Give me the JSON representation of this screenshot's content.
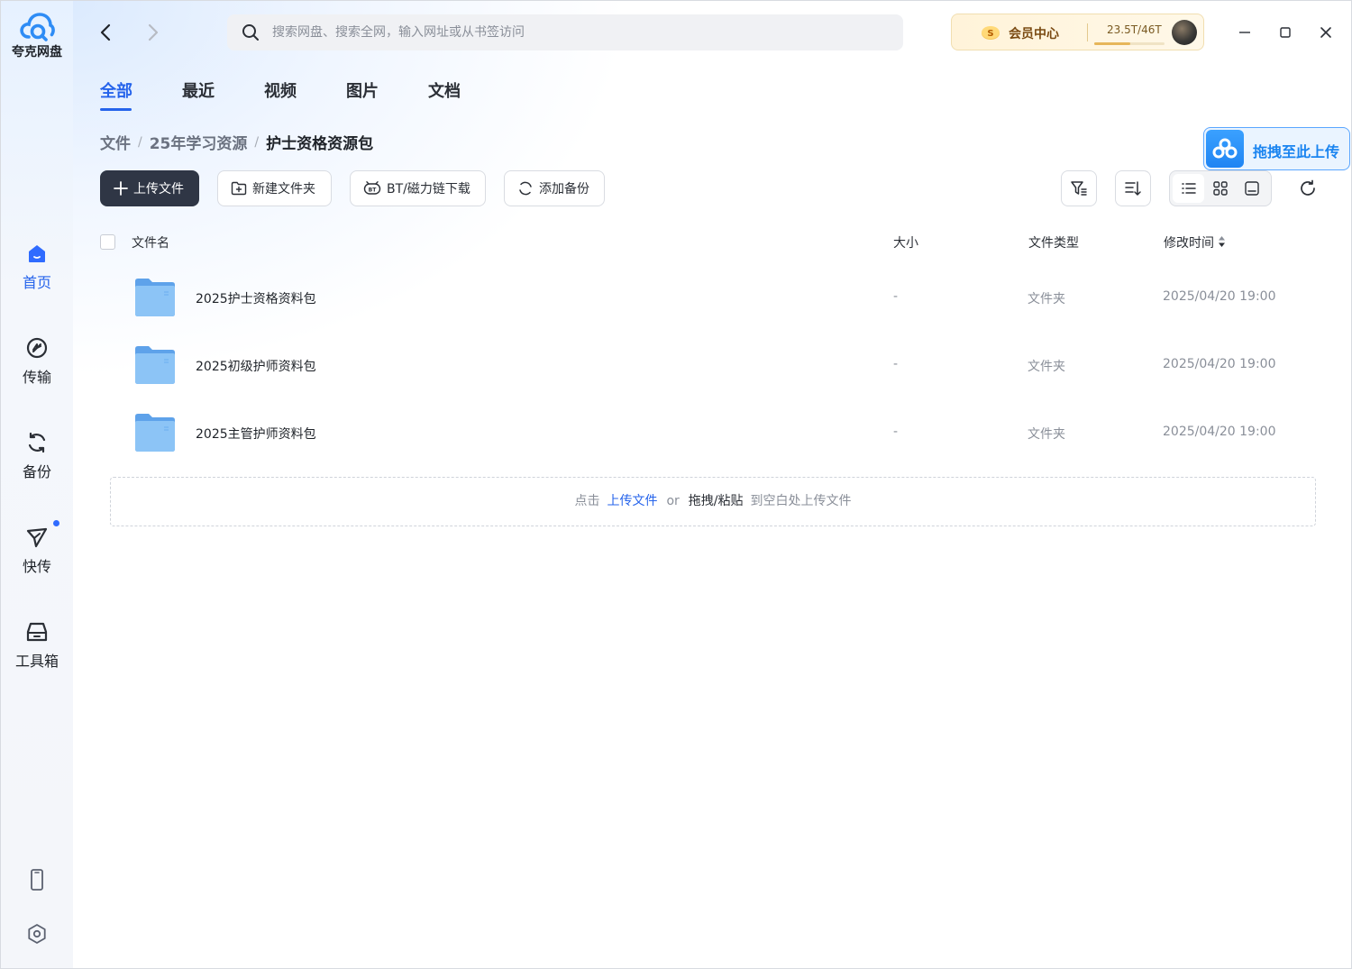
{
  "app": {
    "name": "夸克网盘"
  },
  "sidebar": {
    "items": [
      {
        "label": "首页",
        "icon": "home-icon",
        "active": true
      },
      {
        "label": "传输",
        "icon": "transfer-icon"
      },
      {
        "label": "备份",
        "icon": "backup-icon"
      },
      {
        "label": "快传",
        "icon": "quick-send-icon",
        "badge_dot": true
      },
      {
        "label": "工具箱",
        "icon": "toolbox-icon"
      }
    ],
    "bottom": [
      {
        "icon": "phone-icon"
      },
      {
        "icon": "settings-icon"
      }
    ]
  },
  "topbar": {
    "search_placeholder": "搜索网盘、搜索全网，输入网址或从书签访问",
    "vip_label": "会员中心",
    "storage_text": "23.5T/46T",
    "storage_fraction": 0.51
  },
  "tabs": [
    {
      "label": "全部",
      "active": true
    },
    {
      "label": "最近"
    },
    {
      "label": "视频"
    },
    {
      "label": "图片"
    },
    {
      "label": "文档"
    }
  ],
  "breadcrumb": [
    "文件",
    "25年学习资源",
    "护士资格资源包"
  ],
  "drag_upload_label": "拖拽至此上传",
  "toolbar": {
    "upload": "上传文件",
    "new_folder": "新建文件夹",
    "bt_download": "BT/磁力链下载",
    "add_backup": "添加备份"
  },
  "table": {
    "headers": {
      "name": "文件名",
      "size": "大小",
      "type": "文件类型",
      "modified": "修改时间"
    },
    "rows": [
      {
        "name": "2025护士资格资料包",
        "size": "-",
        "type": "文件夹",
        "modified": "2025/04/20 19:00"
      },
      {
        "name": "2025初级护师资料包",
        "size": "-",
        "type": "文件夹",
        "modified": "2025/04/20 19:00"
      },
      {
        "name": "2025主管护师资料包",
        "size": "-",
        "type": "文件夹",
        "modified": "2025/04/20 19:00"
      }
    ]
  },
  "drop_zone": {
    "prefix": "点击",
    "link": "上传文件",
    "or": "or",
    "strong": "拖拽/粘贴",
    "suffix": "到空白处上传文件"
  },
  "colors": {
    "accent": "#2563eb",
    "primary_button": "#2f3645",
    "folder": "#6aaef0"
  }
}
